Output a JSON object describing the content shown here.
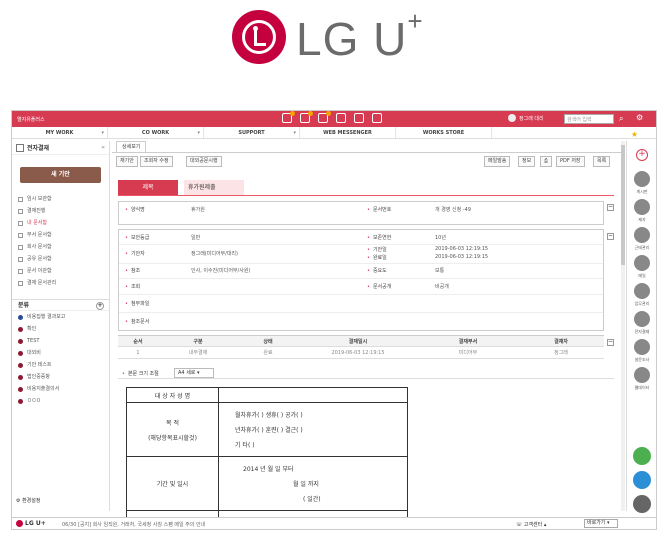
{
  "logo": {
    "text": "LG U",
    "plus": "+"
  },
  "topbar": {
    "brand": "엘지유플러스",
    "user": "정그래 대리",
    "search_placeholder": "검색어 입력"
  },
  "menu": [
    {
      "label": "MY WORK"
    },
    {
      "label": "CO WORK"
    },
    {
      "label": "SUPPORT"
    },
    {
      "label": "WEB MESSENGER"
    },
    {
      "label": "WORKS STORE"
    }
  ],
  "sidebar": {
    "title": "전자결재",
    "new_button": "새 기안",
    "items": [
      "임시 보관함",
      "결재진행",
      "내 문서함",
      "부서 문서함",
      "회사 문서함",
      "공유 문서함",
      "문서 이관함",
      "결재 문서관리"
    ],
    "category_title": "분류",
    "categories": [
      "비용집행 결과보고",
      "확인",
      "TEST",
      "대외비",
      "기안 테스트",
      "법인중증항",
      "비용지출결의서",
      "ㅁㅁㅁ"
    ],
    "env": "환경설정"
  },
  "tab": "상세보기",
  "toolbar": {
    "left": [
      "재기안",
      "조회자 수정",
      "대외공문시행"
    ],
    "right": [
      "메일발송",
      "정보",
      "PDF 저장",
      "목록"
    ]
  },
  "doc": {
    "title_label": "제목",
    "title_value": "휴가원제출",
    "form_name_k": "양식명",
    "form_name_v": "휴가원",
    "doc_no_k": "문서번호",
    "doc_no_v": "개 경영 신청 -49",
    "security_k": "보안등급",
    "security_v": "일반",
    "keep_k": "보존연한",
    "keep_v": "10년",
    "drafter_k": "기안자",
    "drafter_v": "정그래(미디어부/대리)",
    "draft_date_k": "기안일",
    "draft_date_v": "2019-06-03 12:19:15",
    "done_date_k": "완료일",
    "done_date_v": "2019-06-03 12:19:15",
    "ref_k": "참조",
    "ref_v": "인사, 이수진(미디어부/사원)",
    "importance_k": "중요도",
    "importance_v": "보통",
    "view_k": "조회",
    "public_k": "문서공개",
    "public_v": "비공개",
    "attach_k": "첨부파일",
    "refdoc_k": "참조문서"
  },
  "approval": {
    "headers": [
      "순서",
      "구분",
      "상태",
      "결재일시",
      "결재부서",
      "결재자"
    ],
    "rows": [
      [
        "1",
        "내부결재",
        "완료",
        "2019-06-03 12:19:15",
        "미디어부",
        "정그래"
      ]
    ]
  },
  "body": {
    "label": "본문 크기 조절",
    "size": "A4 세로"
  },
  "form": {
    "r1": "대 상 자 성 명",
    "r2a": "목        적",
    "r2b": "(해당항목표시할것)",
    "r2c1": "월차휴가(    )  생휴(    )  공가(    )",
    "r2c2": "년차휴가(    )  훈련(    )  결근(    )",
    "r2c3": "기    타(    )",
    "r3a": "기간 및 일시",
    "r3c1": "2014    년        월        일  부터",
    "r3c2": "월        일  까지",
    "r3c3": "(        일간)"
  },
  "rail": [
    "게시판",
    "제자",
    "근태관리",
    "메일",
    "업무관리",
    "전자결재",
    "설문조사",
    "웹데이터"
  ],
  "footer": {
    "brand": "LG U+",
    "notice": "06/30  [공지] 회사 임직원, 거래처, 국세청 사칭 스팸 메일 주의 안내",
    "cs": "고객센터",
    "goto": "바로가기"
  },
  "colors": {
    "brand": "#d63b52",
    "logo": "#c5003e"
  }
}
